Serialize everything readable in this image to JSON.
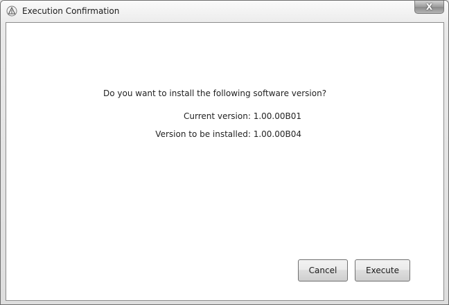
{
  "window": {
    "title": "Execution Confirmation",
    "close_glyph": "X",
    "icon": "app-triangle-icon"
  },
  "dialog": {
    "question": "Do you want to install the following software version?",
    "current_version_text": "Current version: 1.00.00B01",
    "install_version_text": "Version to be installed: 1.00.00B04"
  },
  "buttons": {
    "cancel_label": "Cancel",
    "execute_label": "Execute"
  },
  "colors": {
    "window_border": "#6e6e6e",
    "content_background": "#ffffff",
    "text": "#222222"
  }
}
